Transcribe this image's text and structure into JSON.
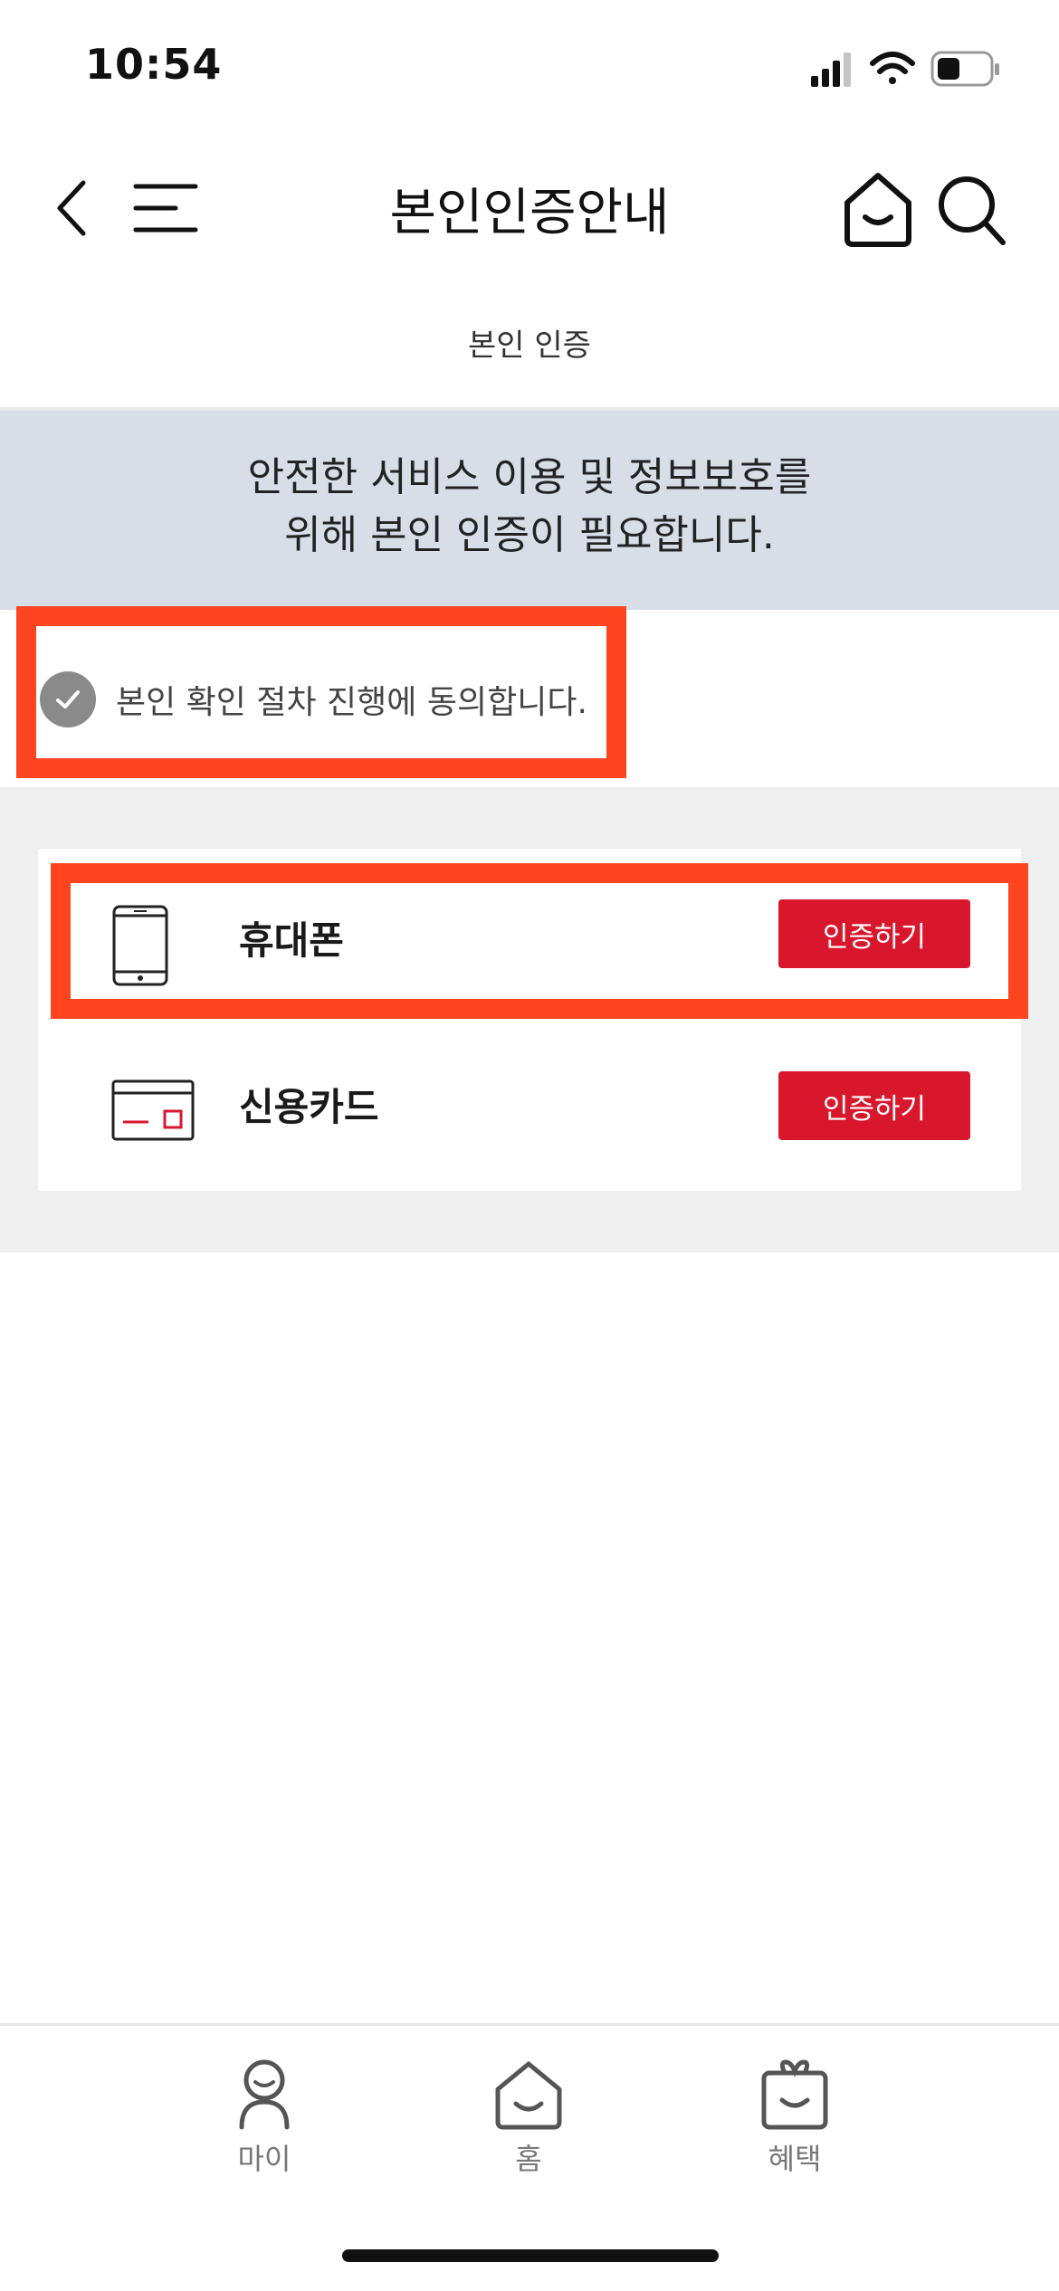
{
  "status_bar": {
    "time": "10:54",
    "icons": [
      "cellular-signal-icon",
      "wifi-icon",
      "battery-icon"
    ]
  },
  "header": {
    "title": "본인인증안내",
    "icons": [
      "back-chevron-icon",
      "menu-icon",
      "home-icon",
      "search-icon"
    ]
  },
  "subtitle": "본인 인증",
  "banner": {
    "line1": "안전한 서비스 이용 및 정보보호를",
    "line2": "위해 본인 인증이 필요합니다."
  },
  "consent": {
    "text": "본인 확인 절차 진행에 동의합니다.",
    "checked": true
  },
  "methods": [
    {
      "label": "휴대폰",
      "button": "인증하기",
      "icon": "mobile-phone-icon"
    },
    {
      "label": "신용카드",
      "button": "인증하기",
      "icon": "credit-card-icon"
    }
  ],
  "tabbar": {
    "items": [
      {
        "label": "마이",
        "icon": "person-icon"
      },
      {
        "label": "홈",
        "icon": "home-icon"
      },
      {
        "label": "혜택",
        "icon": "gift-box-icon"
      }
    ]
  },
  "colors": {
    "accent": "#d9172c",
    "highlight": "#ff451f",
    "banner_bg": "#d8dee8"
  }
}
